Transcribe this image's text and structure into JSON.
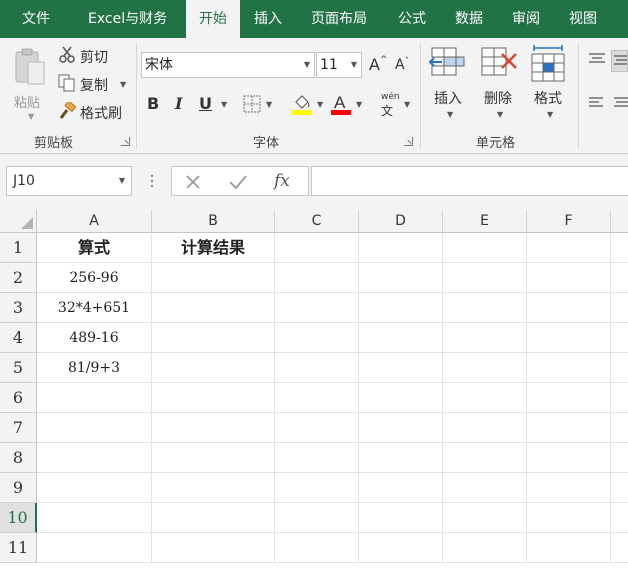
{
  "tabs": [
    {
      "label": "文件",
      "active": false
    },
    {
      "label": "Excel与财务",
      "active": false
    },
    {
      "label": "开始",
      "active": true
    },
    {
      "label": "插入",
      "active": false
    },
    {
      "label": "页面布局",
      "active": false
    },
    {
      "label": "公式",
      "active": false
    },
    {
      "label": "数据",
      "active": false
    },
    {
      "label": "审阅",
      "active": false
    },
    {
      "label": "视图",
      "active": false
    }
  ],
  "ribbon": {
    "clipboard": {
      "title": "剪贴板",
      "paste_label": "粘贴",
      "cut_label": "剪切",
      "copy_label": "复制",
      "format_painter_label": "格式刷"
    },
    "font": {
      "title": "字体",
      "font_name": "宋体",
      "font_size": "11",
      "bold": "B",
      "italic": "I",
      "underline": "U",
      "phonetic": "wén"
    },
    "cells": {
      "title": "单元格",
      "insert_label": "插入",
      "delete_label": "删除",
      "format_label": "格式"
    }
  },
  "formula_bar": {
    "name_box": "J10",
    "fx_label": "fx",
    "formula": ""
  },
  "sheet": {
    "columns": [
      "A",
      "B",
      "C",
      "D",
      "E",
      "F"
    ],
    "rows": [
      "1",
      "2",
      "3",
      "4",
      "5",
      "6",
      "7",
      "8",
      "9",
      "10",
      "11"
    ],
    "selected_row": "10",
    "cells": {
      "A1": "算式",
      "B1": "计算结果",
      "A2": "256-96",
      "A3": "32*4+651",
      "A4": "489-16",
      "A5": "81/9+3"
    }
  },
  "colors": {
    "brand": "#217346",
    "font_highlight": "#ffff00",
    "font_color": "#ff0000"
  }
}
